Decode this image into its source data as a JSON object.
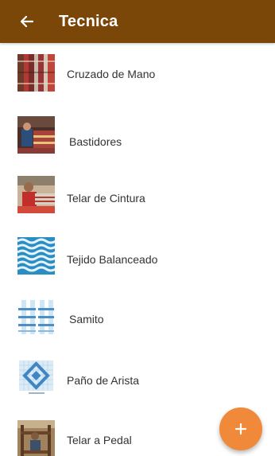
{
  "appbar": {
    "title": "Tecnica",
    "back_icon": "arrow-back-icon",
    "background": "#7b4708"
  },
  "techniques": [
    {
      "label": "Cruzado de Mano",
      "thumbnail": "woven-textile-photo"
    },
    {
      "label": "Bastidores",
      "thumbnail": "weaver-frame-photo"
    },
    {
      "label": "Telar de Cintura",
      "thumbnail": "backstrap-loom-photo"
    },
    {
      "label": "Tejido Balanceado",
      "thumbnail": "balanced-weave-pattern"
    },
    {
      "label": "Samito",
      "thumbnail": "samite-weave-diagram"
    },
    {
      "label": "Paño de Arista",
      "thumbnail": "diamond-weave-diagram"
    },
    {
      "label": "Telar a Pedal",
      "thumbnail": "treadle-loom-photo"
    }
  ],
  "fab": {
    "icon": "plus-icon",
    "color": "#f08a3a"
  }
}
